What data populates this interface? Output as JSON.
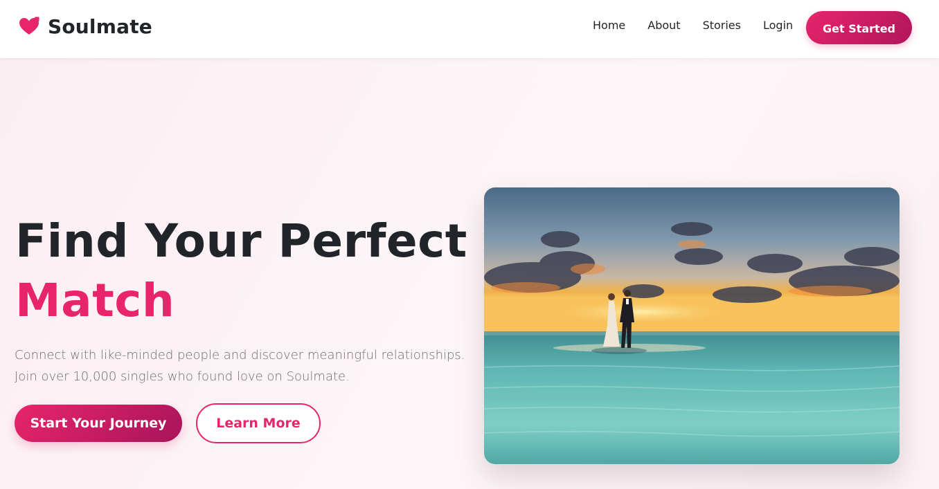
{
  "brand": {
    "name": "Soulmate",
    "icon": "heart-arrow-icon",
    "color": "#e8256b"
  },
  "nav": {
    "links": [
      "Home",
      "About",
      "Stories",
      "Login"
    ],
    "cta": "Get Started"
  },
  "hero": {
    "title_line1": "Find Your Perfect",
    "title_line2": "Match",
    "subtitle_line1": "Connect with like-minded people and discover meaningful relationships.",
    "subtitle_line2": "Join over 10,000 singles who found love on Soulmate.",
    "primary_button": "Start Your Journey",
    "secondary_button": "Learn More",
    "image": "couple-on-beach-at-sunset-photo"
  },
  "colors": {
    "accent": "#e8256b",
    "accent_dark": "#a8145a",
    "text_dark": "#212529",
    "text_muted": "#6c6c72",
    "hero_bg": "#fdf3f6"
  }
}
